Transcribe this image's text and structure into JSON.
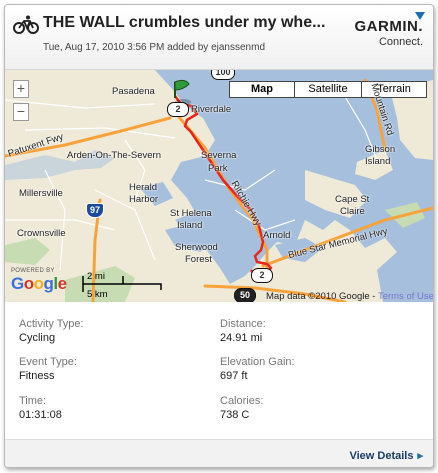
{
  "header": {
    "title": "THE WALL crumbles under my whe...",
    "subtitle": "Tue, Aug 17, 2010 3:56 PM added by ejanssenmd",
    "brand": "GARMIN.",
    "brand_sub": "Connect."
  },
  "map": {
    "zoom_in": "+",
    "zoom_out": "−",
    "types": [
      {
        "label": "Map",
        "active": true
      },
      {
        "label": "Satellite",
        "active": false
      },
      {
        "label": "Terrain",
        "active": false
      }
    ],
    "places": {
      "pasadena": "Pasadena",
      "riverdale": "Riverdale",
      "arden": "Arden-On-The-Severn",
      "severna": "Severna",
      "park": "Park",
      "millersville": "Millersville",
      "herald": "Herald",
      "harbor": "Harbor",
      "st_helena": "St Helena",
      "island": "Island",
      "gibson": "Gibson",
      "gibson_island": "Island",
      "cape": "Cape St",
      "claire": "Claire",
      "crownsville": "Crownsville",
      "sherwood": "Sherwood",
      "forest": "Forest",
      "arnold": "Arnold",
      "patuxent_fwy": "Patuxent Fwy",
      "ritchie_hwy": "Ritchie Hwy",
      "mountain_rd": "Mountain Rd",
      "blue_star": "Blue Star Memorial Hwy"
    },
    "shields": {
      "top": "100",
      "riverdale": "2",
      "i97": "97",
      "route2": "2",
      "route50": "50"
    },
    "powered_by": "POWERED BY",
    "google": [
      "G",
      "o",
      "o",
      "g",
      "l",
      "e"
    ],
    "google_colors": [
      "#3b6fd9",
      "#d23a2b",
      "#f2b31a",
      "#3b6fd9",
      "#2e9b3e",
      "#d23a2b"
    ],
    "scale_mi": "2 mi",
    "scale_km": "5 km",
    "copyright": "Map data ©2010 Google - ",
    "terms": "Terms of Use"
  },
  "stats": {
    "activity_type_label": "Activity Type:",
    "activity_type": "Cycling",
    "distance_label": "Distance:",
    "distance": "24.91 mi",
    "event_type_label": "Event Type:",
    "event_type": "Fitness",
    "elevation_label": "Elevation Gain:",
    "elevation": "697 ft",
    "time_label": "Time:",
    "time": "01:31:08",
    "calories_label": "Calories:",
    "calories": "738 C"
  },
  "footer": {
    "view_details": "View Details",
    "arrow": "▸"
  },
  "colors": {
    "route": "#e8261c",
    "water": "#a5bfdd",
    "land": "#efe9d8",
    "highway": "#f7a23a"
  }
}
